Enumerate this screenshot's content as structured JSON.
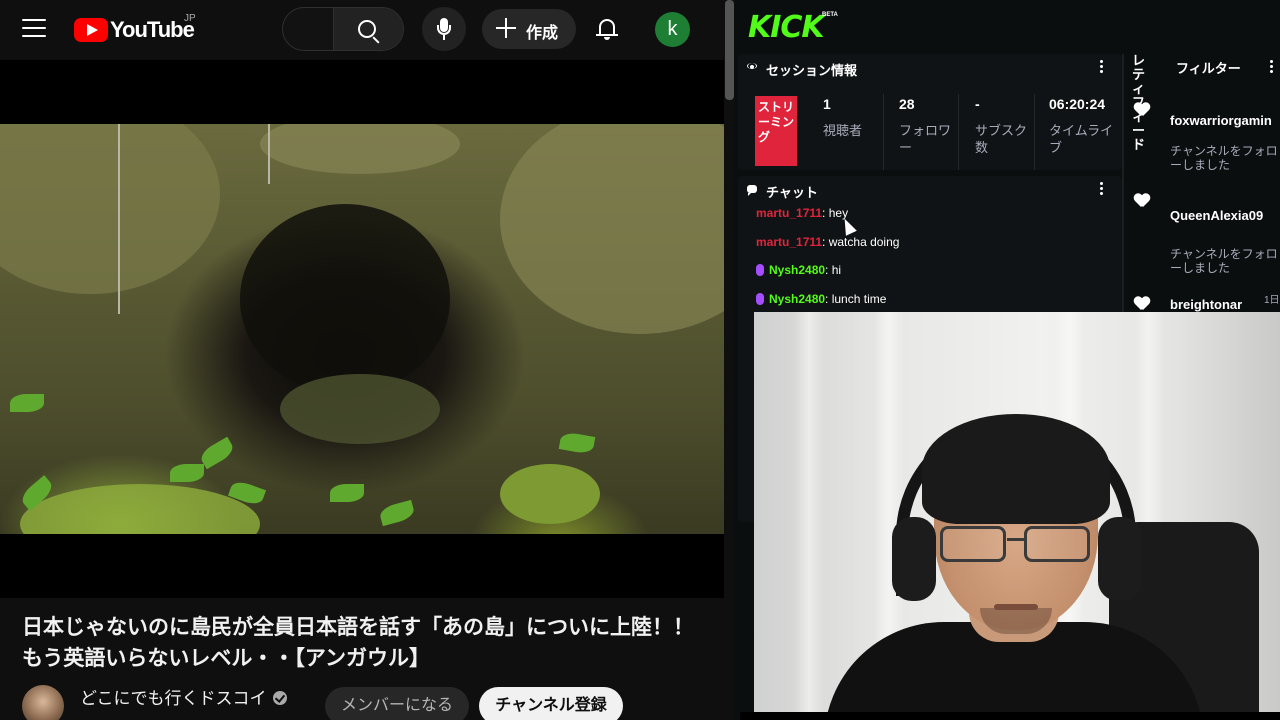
{
  "youtube": {
    "logo_text": "YouTube",
    "region": "JP",
    "create_label": "作成",
    "avatar_letter": "k",
    "video_title": "日本じゃないのに島民が全員日本語を話す「あの島」についに上陸！！もう英語いらないレベル・・【アンガウル】",
    "channel_name": "どこにでも行くドスコイ",
    "member_button": "メンバーになる",
    "subscribe_button": "チャンネル登録",
    "colors": {
      "brand": "#ff0000",
      "avatar": "#1e7e34"
    }
  },
  "kick": {
    "logo": "KICK",
    "beta": "BETA",
    "session": {
      "title": "セッション情報",
      "live_label": "ストリーミング",
      "stats": [
        {
          "value": "1",
          "label": "視聴者"
        },
        {
          "value": "28",
          "label": "フォロワー"
        },
        {
          "value": "-",
          "label": "サブスク数"
        },
        {
          "value": "06:20:24",
          "label": "タイムライブ"
        }
      ]
    },
    "chat": {
      "title": "チャット",
      "messages": [
        {
          "user": "martu_1711",
          "text": ": hey",
          "color": "#e0243c"
        },
        {
          "user": "martu_1711",
          "text": ": watcha doing",
          "color": "#e0243c"
        },
        {
          "user": "Nysh2480",
          "text": ": hi",
          "color": "#53fc18"
        },
        {
          "user": "Nysh2480",
          "text": ": lunch time",
          "color": "#53fc18"
        }
      ]
    },
    "feed": {
      "vertical_label": "レティフィード",
      "filter_label": "フィルター",
      "items": [
        {
          "user": "foxwarriorgamin",
          "action": "チャンネルをフォローしました"
        },
        {
          "user": "QueenAlexia09",
          "action": "チャンネルをフォローしました"
        },
        {
          "user": "breightonar",
          "action": "",
          "time": "1日"
        }
      ]
    },
    "colors": {
      "brand": "#53fc18",
      "live": "#e0243c"
    }
  }
}
